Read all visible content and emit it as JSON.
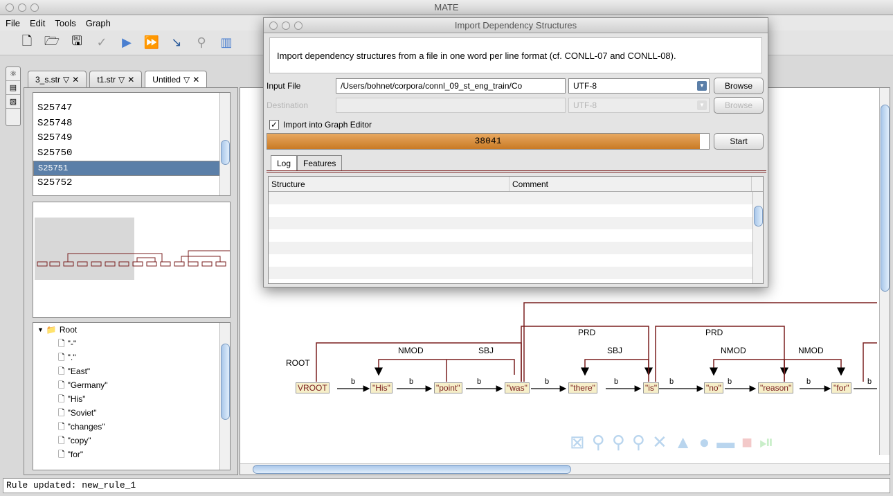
{
  "main_window": {
    "title": "MATE",
    "menu": [
      "File",
      "Edit",
      "Tools",
      "Graph"
    ],
    "tabs": [
      {
        "label": "3_s.str"
      },
      {
        "label": "t1.str"
      },
      {
        "label": "Untitled"
      }
    ]
  },
  "sentence_list": {
    "items": [
      "S25747",
      "S25748",
      "S25749",
      "S25750",
      "S25751",
      "S25752"
    ],
    "selected": "S25751"
  },
  "tree": {
    "root": "Root",
    "items": [
      "\"-\"",
      "\".\"",
      "\"East\"",
      "\"Germany\"",
      "\"His\"",
      "\"Soviet\"",
      "\"changes\"",
      "\"copy\"",
      "\"for\""
    ]
  },
  "graph": {
    "nodes": [
      "VROOT",
      "\"His\"",
      "\"point\"",
      "\"was\"",
      "\"there\"",
      "\"is\"",
      "\"no\"",
      "\"reason\"",
      "\"for\""
    ],
    "edge_label_b": "b",
    "labels": {
      "root": "ROOT",
      "nmod1": "NMOD",
      "sbj1": "SBJ",
      "prd1": "PRD",
      "sbj2": "SBJ",
      "prd2": "PRD",
      "nmod2": "NMOD",
      "nmod3": "NMOD"
    }
  },
  "status": "Rule updated: new_rule_1",
  "dialog": {
    "title": "Import Dependency Structures",
    "description": "Import dependency structures from a file in one word per line format (cf. CONLL-07 and CONLL-08).",
    "input_label": "Input File",
    "input_value": "/Users/bohnet/corpora/connl_09_st_eng_train/Co",
    "input_encoding": "UTF-8",
    "browse_label": "Browse",
    "destination_label": "Destination",
    "destination_encoding": "UTF-8",
    "checkbox_label": "Import into Graph Editor",
    "checkbox_checked": true,
    "progress_value": "38041",
    "progress_fraction": 0.99,
    "start_label": "Start",
    "tabs": [
      "Log",
      "Features"
    ],
    "table_headers": [
      "Structure",
      "Comment"
    ]
  },
  "colors": {
    "selection": "#5b7fa8",
    "progress": "#d08a3c",
    "edge": "#7a1f1f",
    "node_fill": "#f6efc9"
  }
}
